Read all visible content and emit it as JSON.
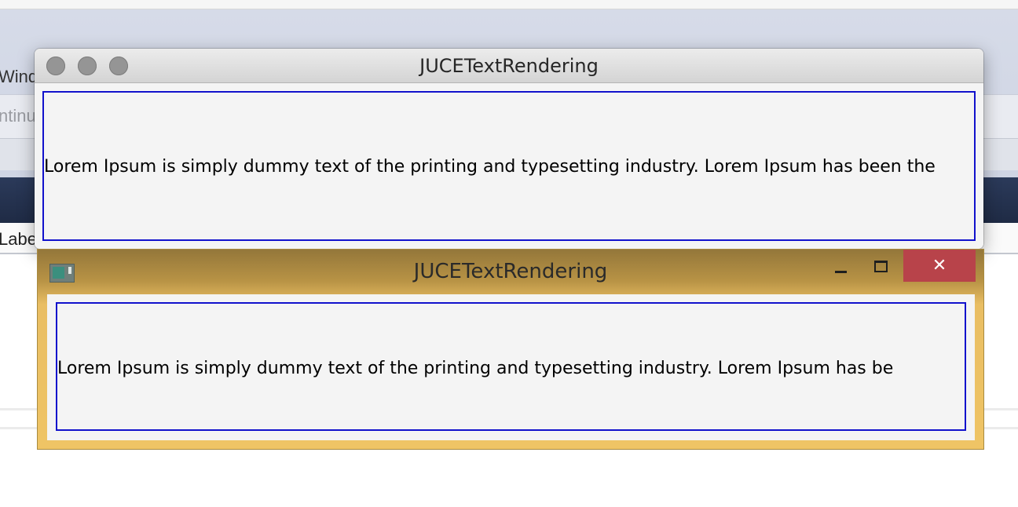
{
  "background_app": {
    "text_window": "Windo",
    "text_continue": "ntinu",
    "text_label": "Labe"
  },
  "mac_window": {
    "title": "JUCETextRendering",
    "text": "Lorem Ipsum is simply dummy text of the printing and typesetting industry. Lorem Ipsum has been the",
    "buttons": [
      "close",
      "minimize",
      "zoom"
    ]
  },
  "win_window": {
    "title": "JUCETextRendering",
    "text": "Lorem Ipsum is simply dummy text of the printing and typesetting industry. Lorem Ipsum has be",
    "close_glyph": "✕"
  },
  "colors": {
    "text_box_border": "#1111cc",
    "win_close_button": "#b8434a",
    "win_frame": "#efc465"
  }
}
